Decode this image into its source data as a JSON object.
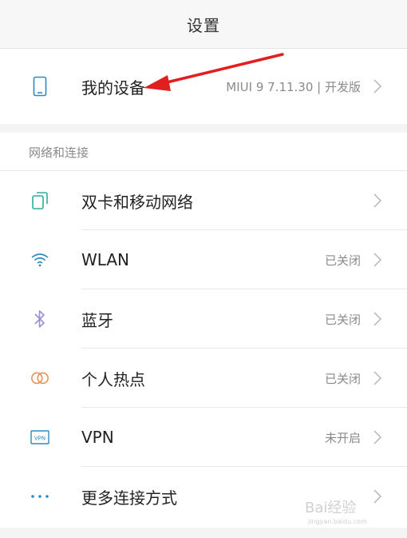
{
  "header": {
    "title": "设置"
  },
  "device": {
    "label": "我的设备",
    "value": "MIUI 9 7.11.30 | 开发版",
    "icon": "phone-icon"
  },
  "network": {
    "section_title": "网络和连接",
    "items": [
      {
        "label": "双卡和移动网络",
        "value": "",
        "icon": "dual-sim-icon"
      },
      {
        "label": "WLAN",
        "value": "已关闭",
        "icon": "wifi-icon"
      },
      {
        "label": "蓝牙",
        "value": "已关闭",
        "icon": "bluetooth-icon"
      },
      {
        "label": "个人热点",
        "value": "已关闭",
        "icon": "hotspot-icon"
      },
      {
        "label": "VPN",
        "value": "未开启",
        "icon": "vpn-icon"
      },
      {
        "label": "更多连接方式",
        "value": "",
        "icon": "more-dots-icon"
      }
    ]
  },
  "watermark": {
    "text": "Bai经验",
    "sub": "jingyan.baidu.com"
  },
  "colors": {
    "accent": "#2c8cbf",
    "arrow": "#e02020",
    "teal": "#2fae9a",
    "bluetooth": "#9b8ed6",
    "hotspot": "#e98a4e"
  }
}
